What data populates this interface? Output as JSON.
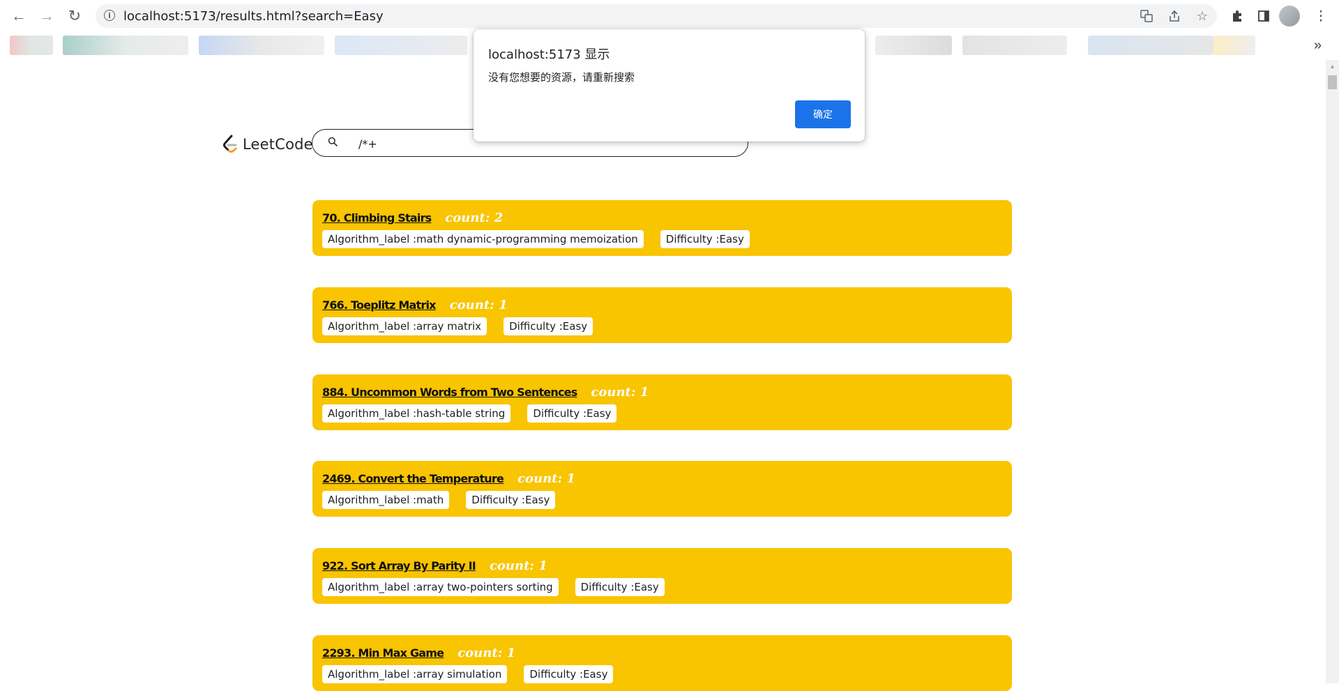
{
  "browser": {
    "url": "localhost:5173/results.html?search=Easy",
    "back_icon": "←",
    "forward_icon": "→",
    "reload_icon": "↻",
    "bookmarks_more": "»"
  },
  "logo": {
    "text": "LeetCode"
  },
  "search": {
    "value": "/*+"
  },
  "results": [
    {
      "title": "70. Climbing Stairs",
      "count": "count: 2",
      "label": "Algorithm_label :math dynamic-programming memoization",
      "difficulty": "Difficulty :Easy"
    },
    {
      "title": "766. Toeplitz Matrix",
      "count": "count: 1",
      "label": "Algorithm_label :array matrix",
      "difficulty": "Difficulty :Easy"
    },
    {
      "title": "884. Uncommon Words from Two Sentences",
      "count": "count: 1",
      "label": "Algorithm_label :hash-table string",
      "difficulty": "Difficulty :Easy"
    },
    {
      "title": "2469. Convert the Temperature",
      "count": "count: 1",
      "label": "Algorithm_label :math",
      "difficulty": "Difficulty :Easy"
    },
    {
      "title": "922. Sort Array By Parity II",
      "count": "count: 1",
      "label": "Algorithm_label :array two-pointers sorting",
      "difficulty": "Difficulty :Easy"
    },
    {
      "title": "2293. Min Max Game",
      "count": "count: 1",
      "label": "Algorithm_label :array simulation",
      "difficulty": "Difficulty :Easy"
    }
  ],
  "dialog": {
    "title": "localhost:5173 显示",
    "message": "没有您想要的资源，请重新搜索",
    "ok_label": "确定"
  },
  "colors": {
    "card_bg": "#f9c400",
    "dialog_button": "#1a73e8"
  }
}
